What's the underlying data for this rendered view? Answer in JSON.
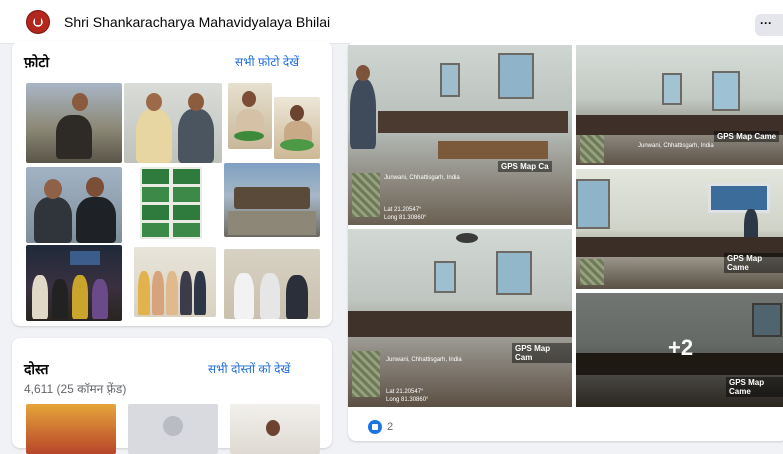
{
  "header": {
    "page_name": "Shri Shankaracharya Mahavidyalaya Bhilai",
    "more_label": "···",
    "logo_icon": "college-seal-icon",
    "logo_color": "#b3261e"
  },
  "photos": {
    "title": "फ़ोटो",
    "see_all_label": "सभी फ़ोटो देखें",
    "link_color": "#216fdb"
  },
  "friends": {
    "title": "दोस्त",
    "see_all_label": "सभी दोस्तों को देखें",
    "count_text": "4,611 (25 कॉमन फ़्रेंड)"
  },
  "post": {
    "gps_label_1": "GPS Map Ca",
    "gps_label_2": "GPS Map Came",
    "gps_label_3": "GPS Map Came",
    "gps_label_4": "GPS Map Cam",
    "gps_label_5": "GPS Map Came",
    "location_1": "Junwani, Chhattisgarh, India",
    "location_2": "Junwani, Chhattisgarh, India",
    "location_3": "Junwani, Chhattisgarh, India",
    "lat_text": "Lat 21.20547°",
    "long_text": "Long 81.30860°",
    "more_photos": "+2",
    "reaction_icon": "like-icon",
    "reaction_count": "2"
  }
}
